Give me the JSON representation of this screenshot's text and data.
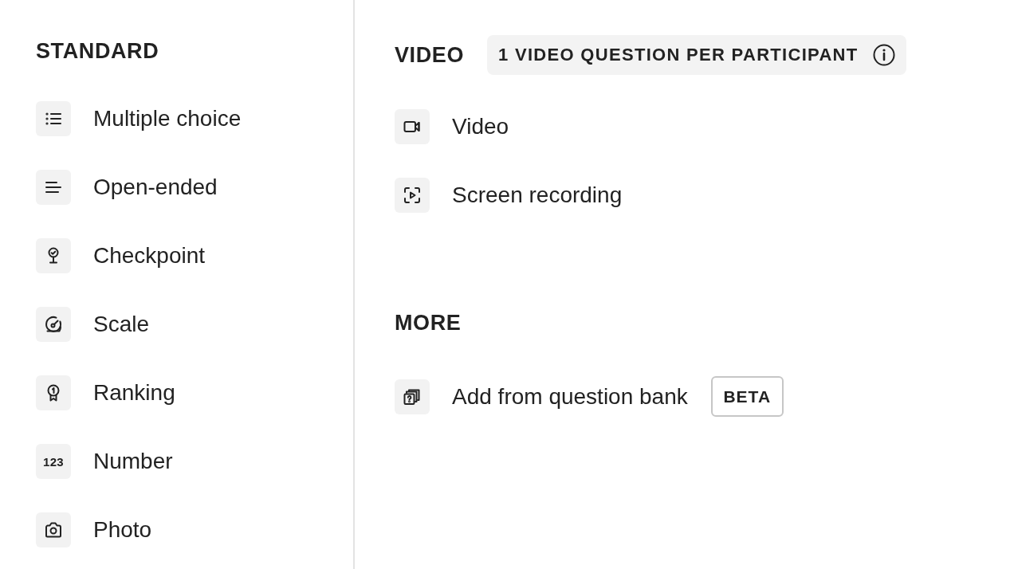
{
  "standard": {
    "heading": "STANDARD",
    "items": [
      {
        "label": "Multiple choice"
      },
      {
        "label": "Open-ended"
      },
      {
        "label": "Checkpoint"
      },
      {
        "label": "Scale"
      },
      {
        "label": "Ranking"
      },
      {
        "label": "Number",
        "icon_text": "123"
      },
      {
        "label": "Photo"
      }
    ]
  },
  "video": {
    "heading": "VIDEO",
    "limit_badge": "1 VIDEO QUESTION PER PARTICIPANT",
    "items": [
      {
        "label": "Video"
      },
      {
        "label": "Screen recording"
      }
    ]
  },
  "more": {
    "heading": "MORE",
    "items": [
      {
        "label": "Add from question bank",
        "tag": "BETA"
      }
    ]
  }
}
